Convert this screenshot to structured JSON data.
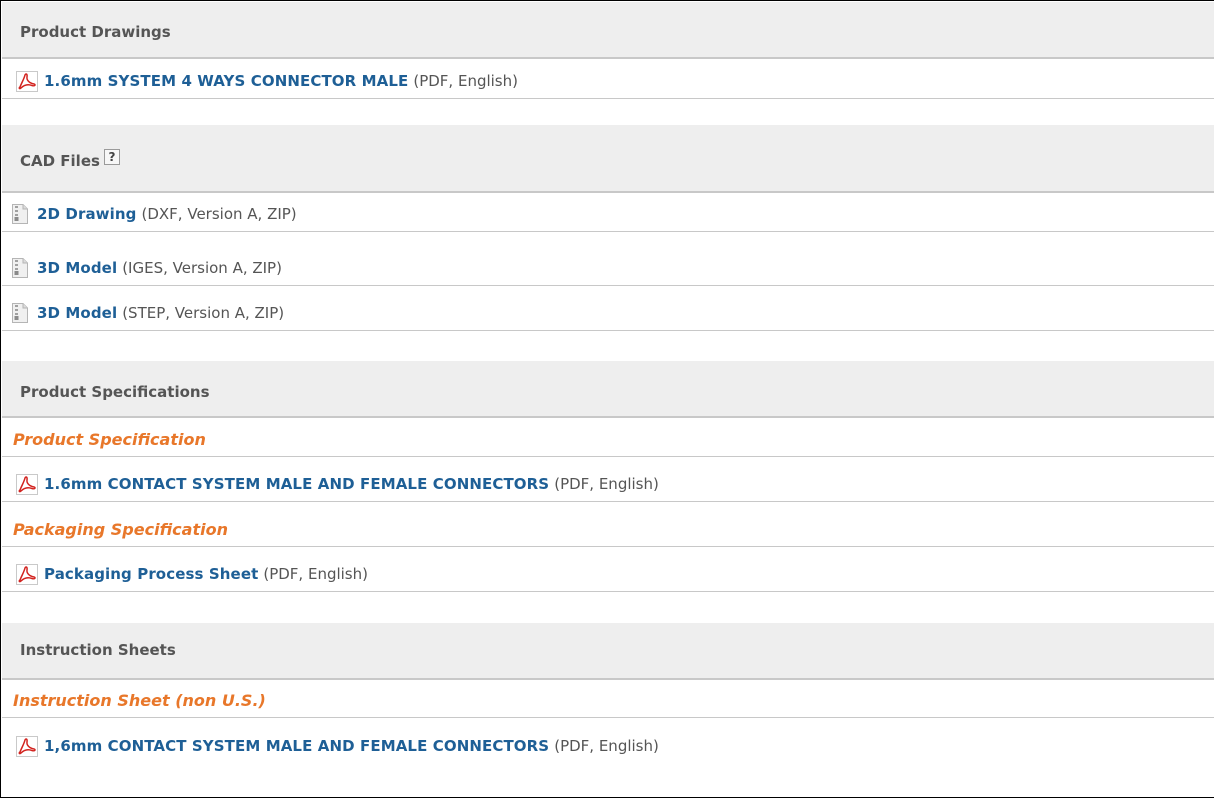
{
  "colors": {
    "link": "#1e5f96",
    "subheading": "#e8772a",
    "heading_bg": "#eeeeee"
  },
  "sections": {
    "product_drawings": {
      "title": "Product Drawings",
      "items": [
        {
          "icon": "pdf-icon",
          "link": "1.6mm SYSTEM 4 WAYS CONNECTOR MALE",
          "meta": "(PDF, English)"
        }
      ]
    },
    "cad_files": {
      "title": "CAD Files",
      "help_label": "?",
      "items": [
        {
          "icon": "zip-file-icon",
          "link": "2D Drawing",
          "meta": "(DXF, Version A, ZIP)"
        },
        {
          "icon": "zip-file-icon",
          "link": "3D Model",
          "meta": "(IGES, Version A, ZIP)"
        },
        {
          "icon": "zip-file-icon",
          "link": "3D Model",
          "meta": "(STEP, Version A, ZIP)"
        }
      ]
    },
    "product_specifications": {
      "title": "Product Specifications",
      "groups": [
        {
          "subheading": "Product Specification",
          "items": [
            {
              "icon": "pdf-icon",
              "link": "1.6mm CONTACT SYSTEM MALE AND FEMALE CONNECTORS",
              "meta": "(PDF, English)"
            }
          ]
        },
        {
          "subheading": "Packaging Specification",
          "items": [
            {
              "icon": "pdf-icon",
              "link": "Packaging Process Sheet",
              "meta": "(PDF, English)"
            }
          ]
        }
      ]
    },
    "instruction_sheets": {
      "title": "Instruction Sheets",
      "groups": [
        {
          "subheading": "Instruction Sheet (non U.S.)",
          "items": [
            {
              "icon": "pdf-icon",
              "link": "1,6mm CONTACT SYSTEM MALE AND FEMALE CONNECTORS",
              "meta": "(PDF, English)"
            }
          ]
        }
      ]
    }
  }
}
